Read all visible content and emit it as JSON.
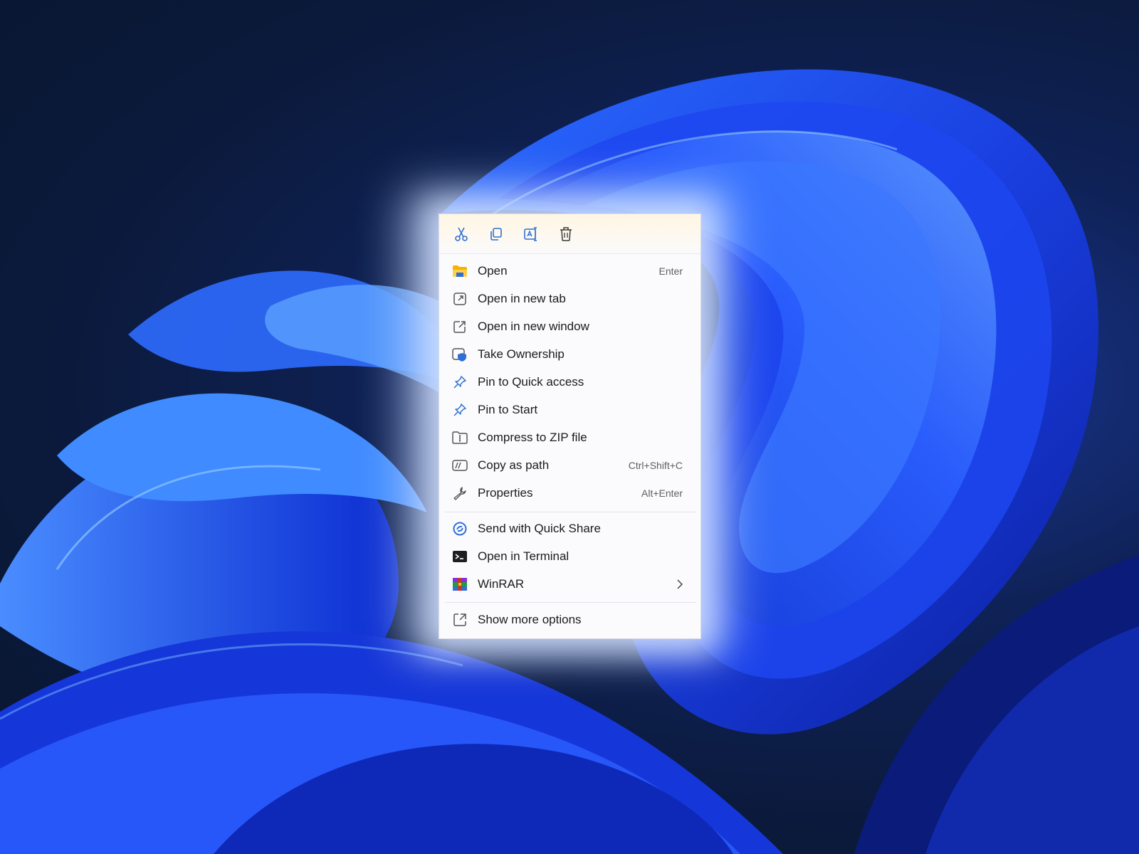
{
  "toolbar": {
    "buttons": [
      {
        "icon": "scissors-icon"
      },
      {
        "icon": "copy-icon"
      },
      {
        "icon": "rename-icon"
      },
      {
        "icon": "trash-icon"
      }
    ]
  },
  "menu": {
    "items": [
      {
        "label": "Open",
        "shortcut": "Enter",
        "icon": "folder-icon"
      },
      {
        "label": "Open in new tab",
        "shortcut": "",
        "icon": "new-tab-icon"
      },
      {
        "label": "Open in new window",
        "shortcut": "",
        "icon": "new-window-icon"
      },
      {
        "label": "Take Ownership",
        "shortcut": "",
        "icon": "shield-icon"
      },
      {
        "label": "Pin to Quick access",
        "shortcut": "",
        "icon": "pin-icon"
      },
      {
        "label": "Pin to Start",
        "shortcut": "",
        "icon": "pin-icon"
      },
      {
        "label": "Compress to ZIP file",
        "shortcut": "",
        "icon": "zip-icon"
      },
      {
        "label": "Copy as path",
        "shortcut": "Ctrl+Shift+C",
        "icon": "path-icon"
      },
      {
        "label": "Properties",
        "shortcut": "Alt+Enter",
        "icon": "wrench-icon"
      },
      {
        "label": "Send with Quick Share",
        "shortcut": "",
        "icon": "quick-share-icon"
      },
      {
        "label": "Open in Terminal",
        "shortcut": "",
        "icon": "terminal-icon"
      },
      {
        "label": "WinRAR",
        "shortcut": "",
        "icon": "winrar-icon"
      },
      {
        "label": "Show more options",
        "shortcut": "",
        "icon": "more-options-icon"
      }
    ]
  },
  "colors": {
    "accent": "#2f6fd6",
    "menu_bg": "#fbfbfd",
    "wallpaper_dark": "#0a1630",
    "wallpaper_blue": "#1f4fe0"
  }
}
